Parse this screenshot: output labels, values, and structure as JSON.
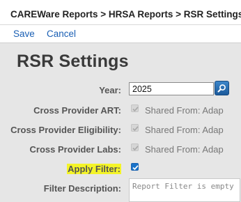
{
  "breadcrumb": "CAREWare Reports > HRSA Reports > RSR Settings",
  "toolbar": {
    "save_label": "Save",
    "cancel_label": "Cancel"
  },
  "page_title": "RSR Settings",
  "form": {
    "year": {
      "label": "Year:",
      "value": "2025",
      "search_icon": "search-icon"
    },
    "cross_provider_art": {
      "label": "Cross Provider ART:",
      "checked": true,
      "disabled": true,
      "shared_text": "Shared From: Adap"
    },
    "cross_provider_eligibility": {
      "label": "Cross Provider Eligibility:",
      "checked": true,
      "disabled": true,
      "shared_text": "Shared From: Adap"
    },
    "cross_provider_labs": {
      "label": "Cross Provider Labs:",
      "checked": true,
      "disabled": true,
      "shared_text": "Shared From: Adap"
    },
    "apply_filter": {
      "label": "Apply Filter:",
      "checked": true,
      "highlight_color": "#f4f428"
    },
    "filter_description": {
      "label": "Filter Description:",
      "value": "Report Filter is empty"
    }
  },
  "colors": {
    "link": "#1a5fb4",
    "checkbox_active": "#1a73c9",
    "background": "#e6e6e6"
  }
}
